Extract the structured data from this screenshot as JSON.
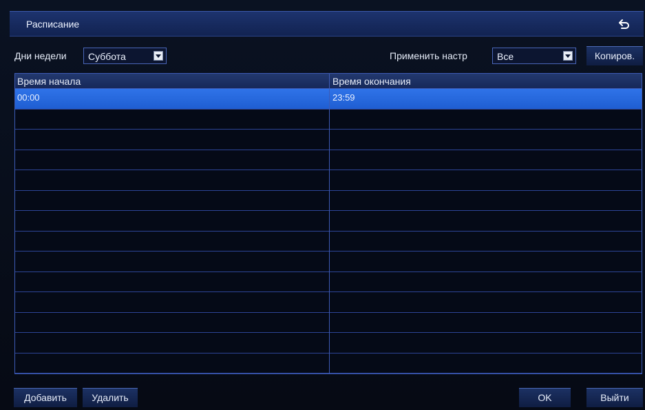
{
  "title": "Расписание",
  "toolbar": {
    "days_label": "Дни недели",
    "day_value": "Суббота",
    "apply_label": "Применить настр",
    "apply_value": "Все",
    "copy_button": "Копиров."
  },
  "table": {
    "columns": [
      "Время начала",
      "Время окончания"
    ],
    "rows": [
      {
        "start": "00:00",
        "end": "23:59",
        "selected": true
      },
      {
        "start": "",
        "end": ""
      },
      {
        "start": "",
        "end": ""
      },
      {
        "start": "",
        "end": ""
      },
      {
        "start": "",
        "end": ""
      },
      {
        "start": "",
        "end": ""
      },
      {
        "start": "",
        "end": ""
      },
      {
        "start": "",
        "end": ""
      },
      {
        "start": "",
        "end": ""
      },
      {
        "start": "",
        "end": ""
      },
      {
        "start": "",
        "end": ""
      },
      {
        "start": "",
        "end": ""
      },
      {
        "start": "",
        "end": ""
      },
      {
        "start": "",
        "end": ""
      }
    ]
  },
  "footer": {
    "add": "Добавить",
    "delete": "Удалить",
    "ok": "OK",
    "exit": "Выйти"
  },
  "icons": {
    "back": "back-arrow-icon",
    "dropdown": "chevron-down-icon"
  },
  "colors": {
    "accent": "#2f73e8",
    "header": "#1d336e",
    "border": "#3d5bb5"
  }
}
